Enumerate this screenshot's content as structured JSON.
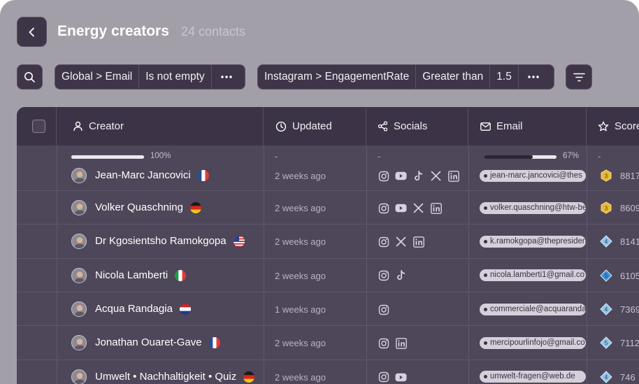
{
  "header": {
    "title": "Energy creators",
    "subtitle": "24 contacts"
  },
  "filters": [
    {
      "field": "Global > Email",
      "operator": "Is not empty",
      "value": ""
    },
    {
      "field": "Instagram > EngagementRate",
      "operator": "Greater than",
      "value": "1.5"
    }
  ],
  "columns": {
    "creator": "Creator",
    "updated": "Updated",
    "socials": "Socials",
    "email": "Email",
    "score": "Score"
  },
  "summary": {
    "creator_progress": 1.0,
    "creator_pct": "100%",
    "updated": "-",
    "socials": "-",
    "email_progress": 0.67,
    "email_pct": "67%",
    "score": "-"
  },
  "rows": [
    {
      "name": "Jean-Marc Jancovici",
      "flag": "fr",
      "updated": "2 weeks ago",
      "socials": [
        "instagram-icon",
        "youtube-icon",
        "tiktok-icon",
        "x-icon",
        "linkedin-icon"
      ],
      "email": "jean-marc.jancovici@thes",
      "badge": "3",
      "badge_type": "gold",
      "score": "8817"
    },
    {
      "name": "Volker Quaschning",
      "flag": "de",
      "updated": "2 weeks ago",
      "socials": [
        "instagram-icon",
        "youtube-icon",
        "x-icon",
        "linkedin-icon"
      ],
      "email": "volker.quaschning@htw-be",
      "badge": "3",
      "badge_type": "gold",
      "score": "8609"
    },
    {
      "name": "Dr Kgosientsho Ramokgopa",
      "flag": "us",
      "updated": "2 weeks ago",
      "socials": [
        "instagram-icon",
        "x-icon",
        "linkedin-icon"
      ],
      "email": "k.ramokgopa@thepresiden",
      "badge": "4",
      "badge_type": "diamond",
      "score": "8141"
    },
    {
      "name": "Nicola Lamberti",
      "flag": "it",
      "updated": "2 weeks ago",
      "socials": [
        "instagram-icon",
        "tiktok-icon"
      ],
      "email": "nicola.lamberti1@gmail.co",
      "badge": "5",
      "badge_type": "blue",
      "score": "6105"
    },
    {
      "name": "Acqua Randagia",
      "flag": "nl",
      "updated": "1 weeks ago",
      "socials": [
        "instagram-icon"
      ],
      "email": "commerciale@acquarandag",
      "badge": "4",
      "badge_type": "diamond",
      "score": "7369"
    },
    {
      "name": "Jonathan Ouaret-Gave",
      "flag": "fr",
      "updated": "2 weeks ago",
      "socials": [
        "instagram-icon",
        "linkedin-icon"
      ],
      "email": "mercipourlinfojo@gmail.co",
      "badge": "5",
      "badge_type": "diamond",
      "score": "7112"
    },
    {
      "name": "Umwelt • Nachhaltigkeit • Quiz",
      "flag": "de",
      "updated": "2 weeks ago",
      "socials": [
        "instagram-icon",
        "youtube-icon"
      ],
      "email": "umwelt-fragen@web.de",
      "badge": "4",
      "badge_type": "diamond",
      "score": "746"
    }
  ],
  "colors": {
    "background": "#a29fa8",
    "table": "#4e4659",
    "header": "#3c3446",
    "pill": "#d4cfda"
  }
}
